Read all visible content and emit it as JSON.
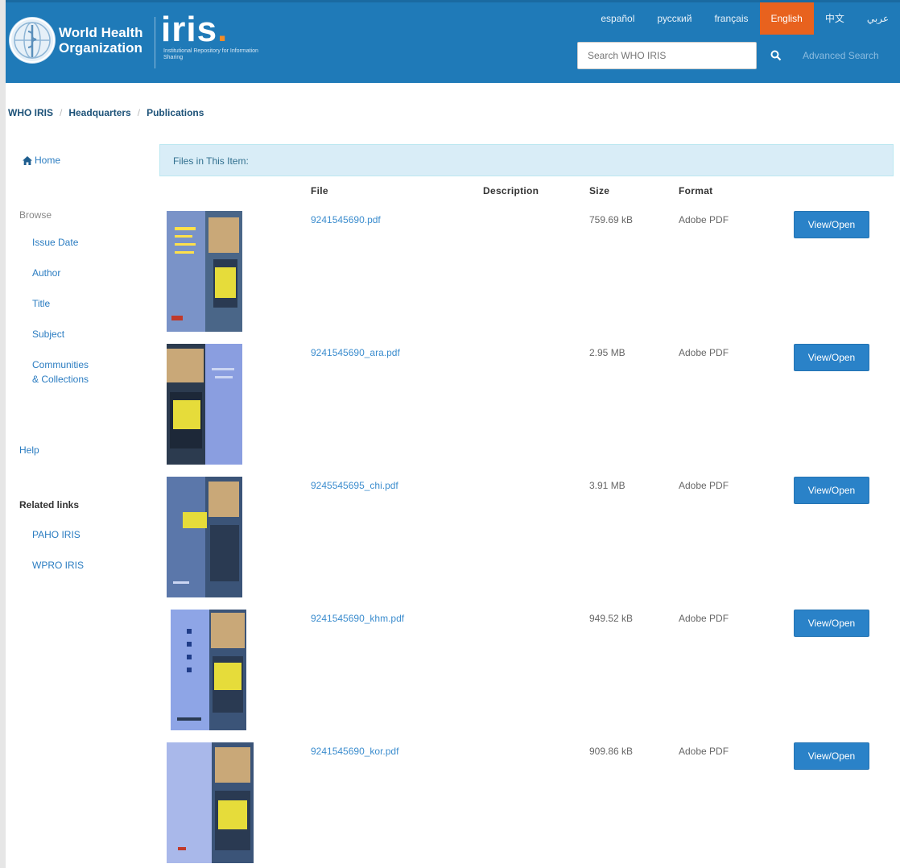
{
  "header": {
    "org_name_line1": "World Health",
    "org_name_line2": "Organization",
    "iris_word": "iris",
    "iris_dot": ".",
    "iris_sub": "Institutional Repository for Information Sharing",
    "languages": [
      "español",
      "русский",
      "français",
      "English",
      "中文",
      "عربي"
    ],
    "active_language": "English",
    "search_placeholder": "Search WHO IRIS",
    "advanced_search": "Advanced Search",
    "colors": {
      "header_bg": "#1f7ab8",
      "active_lang": "#e8621e"
    }
  },
  "breadcrumb": [
    "WHO IRIS",
    "Headquarters",
    "Publications"
  ],
  "sidebar": {
    "home": "Home",
    "browse_heading": "Browse",
    "browse_items": [
      "Issue Date",
      "Author",
      "Title",
      "Subject",
      "Communities",
      "& Collections"
    ],
    "help": "Help",
    "related_heading": "Related links",
    "related_items": [
      "PAHO IRIS",
      "WPRO IRIS"
    ]
  },
  "files": {
    "panel_title": "Files in This Item:",
    "columns": [
      "File",
      "Description",
      "Size",
      "Format"
    ],
    "rows": [
      {
        "name": "9241545690.pdf",
        "description": "",
        "size": "759.69 kB",
        "format": "Adobe PDF",
        "action": "View/Open"
      },
      {
        "name": "9241545690_ara.pdf",
        "description": "",
        "size": "2.95 MB",
        "format": "Adobe PDF",
        "action": "View/Open"
      },
      {
        "name": "9245545695_chi.pdf",
        "description": "",
        "size": "3.91 MB",
        "format": "Adobe PDF",
        "action": "View/Open"
      },
      {
        "name": "9241545690_khm.pdf",
        "description": "",
        "size": "949.52 kB",
        "format": "Adobe PDF",
        "action": "View/Open"
      },
      {
        "name": "9241545690_kor.pdf",
        "description": "",
        "size": "909.86 kB",
        "format": "Adobe PDF",
        "action": "View/Open"
      }
    ]
  },
  "icons": [
    "who-emblem-icon",
    "search-icon",
    "home-icon"
  ]
}
